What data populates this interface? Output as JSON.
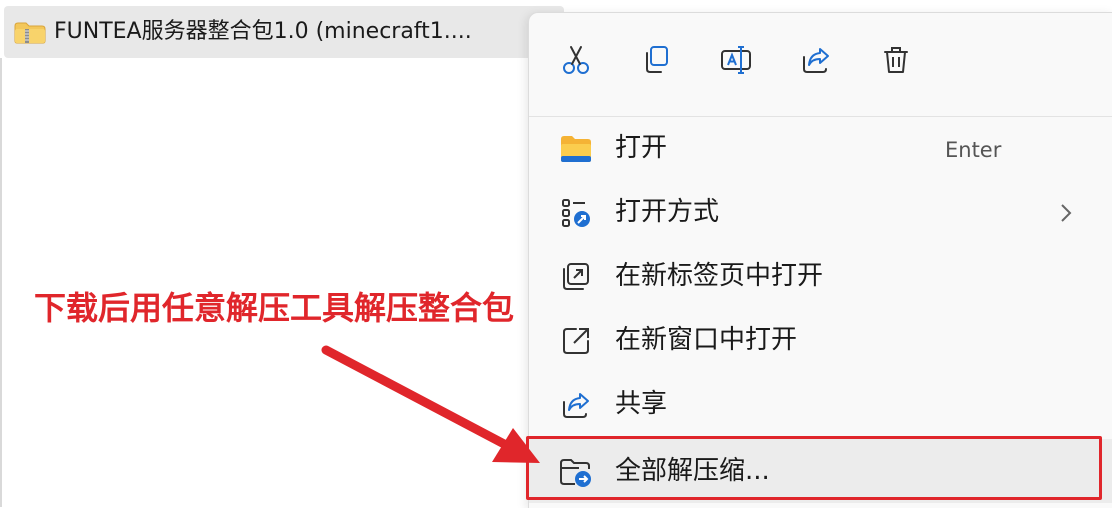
{
  "file": {
    "name": "FUNTEA服务器整合包1.0 (minecraft1....",
    "icon": "zip-folder-icon"
  },
  "context_menu": {
    "quick_actions": [
      {
        "name": "cut",
        "icon": "scissors-icon"
      },
      {
        "name": "copy",
        "icon": "copy-icon"
      },
      {
        "name": "rename",
        "icon": "rename-icon"
      },
      {
        "name": "share",
        "icon": "share-icon"
      },
      {
        "name": "delete",
        "icon": "trash-icon"
      }
    ],
    "items": [
      {
        "label": "打开",
        "shortcut": "Enter",
        "icon": "folder-icon"
      },
      {
        "label": "打开方式",
        "icon": "open-with-icon",
        "has_submenu": true
      },
      {
        "label": "在新标签页中打开",
        "icon": "new-tab-icon"
      },
      {
        "label": "在新窗口中打开",
        "icon": "new-window-icon"
      },
      {
        "label": "共享",
        "icon": "share-icon"
      },
      {
        "label": "全部解压缩...",
        "icon": "extract-all-icon",
        "highlighted": true
      }
    ]
  },
  "annotation": {
    "text": "下载后用任意解压工具解压整合包",
    "color": "#e0262b"
  },
  "colors": {
    "accent_blue": "#1f6fd1",
    "folder_yellow": "#f5b335",
    "highlight_red": "#e0262b"
  }
}
